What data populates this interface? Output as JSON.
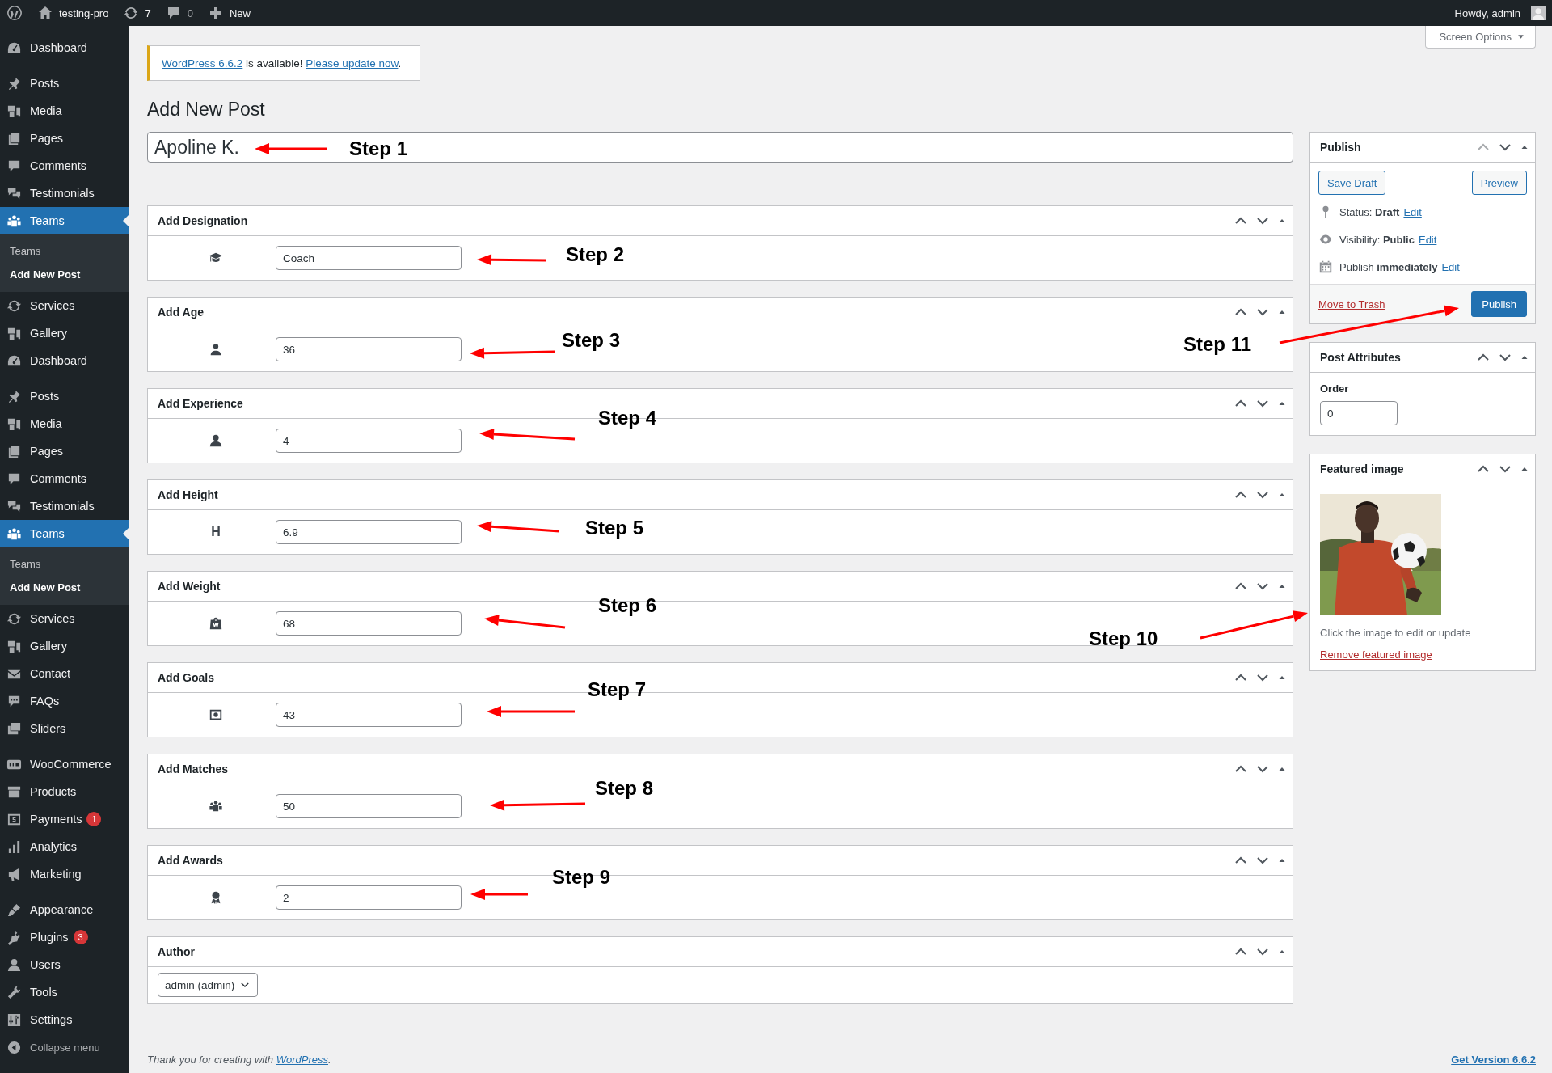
{
  "admin_bar": {
    "site": "testing-pro",
    "updates": "7",
    "comments": "0",
    "new": "New",
    "greeting": "Howdy, admin"
  },
  "sidebar": {
    "groups": [
      {
        "items": [
          {
            "label": "Dashboard",
            "current": false
          }
        ]
      },
      {
        "items": [
          {
            "label": "Posts",
            "current": false
          },
          {
            "label": "Media",
            "current": false
          },
          {
            "label": "Pages",
            "current": false
          },
          {
            "label": "Comments",
            "current": false
          },
          {
            "label": "Testimonials",
            "current": false
          },
          {
            "label": "Teams",
            "current": true,
            "submenu": [
              {
                "label": "Teams",
                "selected": false
              },
              {
                "label": "Add New Post",
                "selected": true
              }
            ]
          },
          {
            "label": "Services",
            "current": false
          },
          {
            "label": "Gallery",
            "current": false
          },
          {
            "label": "Dashboard",
            "current": false
          }
        ]
      },
      {
        "items": [
          {
            "label": "Posts",
            "current": false
          },
          {
            "label": "Media",
            "current": false
          },
          {
            "label": "Pages",
            "current": false
          },
          {
            "label": "Comments",
            "current": false
          },
          {
            "label": "Testimonials",
            "current": false
          },
          {
            "label": "Teams",
            "current": true,
            "submenu": [
              {
                "label": "Teams",
                "selected": false
              },
              {
                "label": "Add New Post",
                "selected": true
              }
            ]
          },
          {
            "label": "Services",
            "current": false
          },
          {
            "label": "Gallery",
            "current": false
          },
          {
            "label": "Contact",
            "current": false
          },
          {
            "label": "FAQs",
            "current": false
          },
          {
            "label": "Sliders",
            "current": false
          }
        ]
      },
      {
        "items": [
          {
            "label": "WooCommerce",
            "current": false
          },
          {
            "label": "Products",
            "current": false
          },
          {
            "label": "Payments",
            "current": false,
            "badge": "1"
          },
          {
            "label": "Analytics",
            "current": false
          },
          {
            "label": "Marketing",
            "current": false
          }
        ]
      },
      {
        "items": [
          {
            "label": "Appearance",
            "current": false
          },
          {
            "label": "Plugins",
            "current": false,
            "badge": "3"
          },
          {
            "label": "Users",
            "current": false
          },
          {
            "label": "Tools",
            "current": false
          },
          {
            "label": "Settings",
            "current": false
          }
        ]
      }
    ],
    "collapse": "Collapse menu"
  },
  "screen_options": "Screen Options",
  "notice": {
    "version_link": "WordPress 6.6.2",
    "text": " is available! ",
    "update_link": "Please update now",
    "end": "."
  },
  "page_title": "Add New Post",
  "post_title": "Apoline K.",
  "metaboxes": [
    {
      "title": "Add Designation",
      "value": "Coach"
    },
    {
      "title": "Add Age",
      "value": "36"
    },
    {
      "title": "Add Experience",
      "value": "4"
    },
    {
      "title": "Add Height",
      "value": "6.9",
      "icon_text": "H"
    },
    {
      "title": "Add Weight",
      "value": "68"
    },
    {
      "title": "Add Goals",
      "value": "43"
    },
    {
      "title": "Add Matches",
      "value": "50"
    },
    {
      "title": "Add Awards",
      "value": "2"
    }
  ],
  "author": {
    "title": "Author",
    "value": "admin (admin)"
  },
  "publish": {
    "title": "Publish",
    "save_draft": "Save Draft",
    "preview": "Preview",
    "rows": [
      {
        "text": "Status: **Draft**",
        "link": "Edit"
      },
      {
        "text": "Visibility: **Public**",
        "link": "Edit"
      },
      {
        "text": "Publish **immediately**",
        "link": "Edit"
      }
    ],
    "trash": "Move to Trash",
    "button": "Publish"
  },
  "attributes": {
    "title": "Post Attributes",
    "label": "Order",
    "value": "0"
  },
  "featured": {
    "title": "Featured image",
    "caption": "Click the image to edit or update",
    "remove": "Remove featured image"
  },
  "annotations": [
    "Step 1",
    "Step 2",
    "Step 3",
    "Step 4",
    "Step 5",
    "Step 6",
    "Step 7",
    "Step 8",
    "Step 9",
    "Step 10",
    "Step 11"
  ],
  "footer": {
    "text": "Thank you for creating with ",
    "link": "WordPress",
    "end": ".",
    "version": "Get Version 6.6.2"
  }
}
